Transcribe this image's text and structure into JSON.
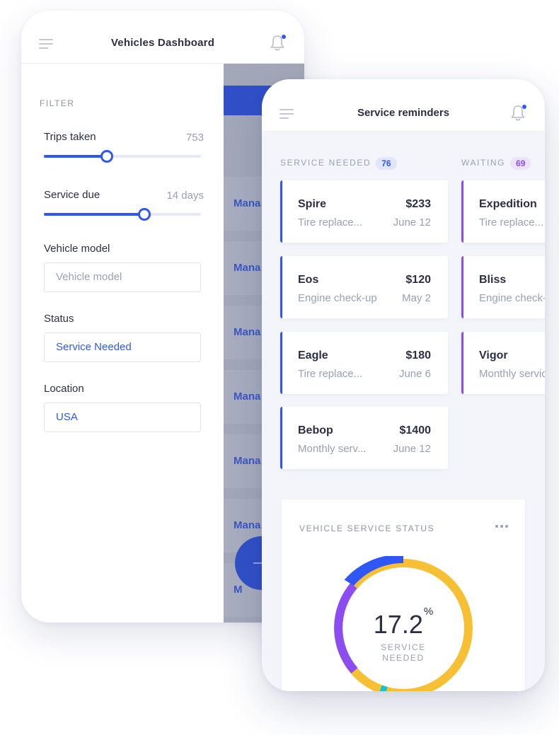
{
  "dashboard": {
    "title": "Vehicles Dashboard",
    "filter_label": "FILTER",
    "trips": {
      "label": "Trips taken",
      "value": "753",
      "level": 0.4
    },
    "service_due": {
      "label": "Service due",
      "value": "14 days",
      "level": 0.64
    },
    "vehicle_model": {
      "label": "Vehicle model",
      "placeholder": "Vehicle model"
    },
    "status": {
      "label": "Status",
      "value": "Service Needed"
    },
    "location": {
      "label": "Location",
      "value": "USA"
    },
    "overlay_rows": [
      "Mana",
      "Mana",
      "Mana",
      "Mana",
      "Mana",
      "Mana",
      "M"
    ]
  },
  "reminders": {
    "title": "Service reminders",
    "columns": [
      {
        "title": "SERVICE NEEDED",
        "count": "76",
        "cards": [
          {
            "name": "Spire",
            "price": "$233",
            "desc": "Tire replace...",
            "date": "June 12"
          },
          {
            "name": "Eos",
            "price": "$120",
            "desc": "Engine check-up",
            "date": "May 2"
          },
          {
            "name": "Eagle",
            "price": "$180",
            "desc": "Tire replace...",
            "date": "June 6"
          },
          {
            "name": "Bebop",
            "price": "$1400",
            "desc": "Monthly serv...",
            "date": "June 12"
          }
        ]
      },
      {
        "title": "WAITING",
        "count": "69",
        "cards": [
          {
            "name": "Expedition",
            "desc": "Tire replace..."
          },
          {
            "name": "Bliss",
            "desc": "Engine check-up"
          },
          {
            "name": "Vigor",
            "desc": "Monthly service"
          }
        ]
      }
    ]
  },
  "service_status": {
    "title": "VEHICLE SERVICE STATUS",
    "value": "17.2",
    "unit": "%",
    "label_line1": "SERVICE",
    "label_line2": "NEEDED",
    "colors": {
      "service_needed": "#2f57f5",
      "waiting": "#f7bf34",
      "other_purple": "#8b4cf2",
      "other_teal": "#11c1d8"
    }
  },
  "colors": {
    "accent": "#2f57f5",
    "purple": "#8b4cf2"
  }
}
